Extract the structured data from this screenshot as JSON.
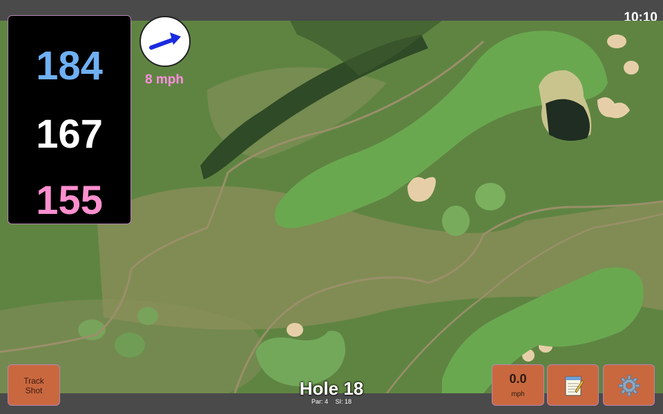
{
  "status_bar": {
    "time": "10:10"
  },
  "yardages": {
    "back": "184",
    "middle": "167",
    "front": "155",
    "colors": {
      "back": "#6fb0f3",
      "middle": "#ffffff",
      "front": "#ff8fcf"
    }
  },
  "wind": {
    "speed": "8 mph",
    "direction_icon": "arrow-icon"
  },
  "buttons": {
    "track_shot_line1": "Track",
    "track_shot_line2": "Shot",
    "speed_value": "0.0",
    "speed_unit": "mph",
    "notes_icon": "notepad-icon",
    "settings_icon": "gear-icon"
  },
  "hole": {
    "title": "Hole 18",
    "par": "Par: 4",
    "stroke_index": "SI: 18"
  }
}
